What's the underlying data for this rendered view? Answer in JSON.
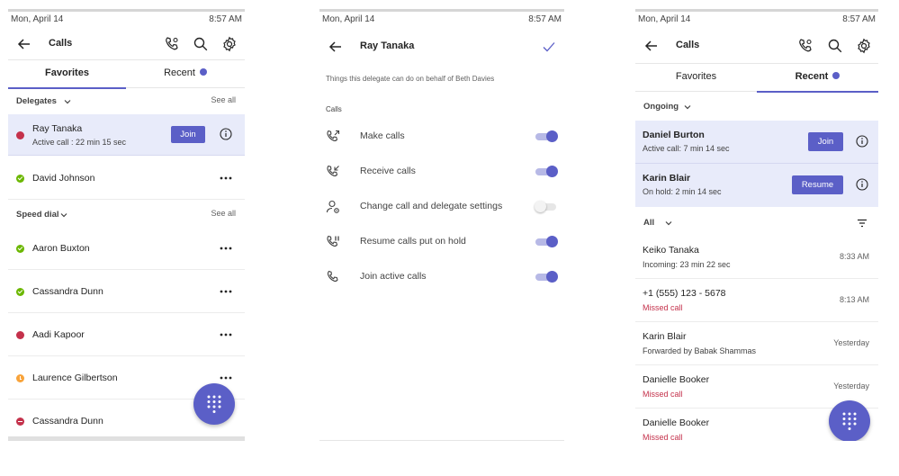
{
  "status": {
    "date": "Mon, April 14",
    "time": "8:57 AM"
  },
  "screen1": {
    "title": "Calls",
    "tabs": [
      {
        "label": "Favorites",
        "active": true
      },
      {
        "label": "Recent",
        "active": false,
        "badge": true
      }
    ],
    "delegates_section": {
      "label": "Delegates",
      "see_all": "See all"
    },
    "delegates": [
      {
        "name": "Ray Tanaka",
        "sub": "Active call : 22 min 15 sec",
        "presence": "red",
        "action": "Join",
        "highlighted": true
      },
      {
        "name": "David Johnson",
        "presence": "available"
      }
    ],
    "speed_dial_section": {
      "label": "Speed dial",
      "see_all": "See all"
    },
    "speed_dial": [
      {
        "name": "Aaron Buxton",
        "presence": "available"
      },
      {
        "name": "Cassandra Dunn",
        "presence": "available"
      },
      {
        "name": "Aadi Kapoor",
        "presence": "busy"
      },
      {
        "name": "Laurence Gilbertson",
        "presence": "away"
      },
      {
        "name": "Cassandra Dunn",
        "presence": "dnd"
      }
    ]
  },
  "screen2": {
    "title": "Ray Tanaka",
    "description": "Things this delegate can do on behalf of Beth Davies",
    "section_label": "Calls",
    "permissions": [
      {
        "label": "Make calls",
        "icon": "phone-outgoing-icon",
        "enabled": true
      },
      {
        "label": "Receive calls",
        "icon": "phone-incoming-icon",
        "enabled": true
      },
      {
        "label": "Change call and delegate settings",
        "icon": "person-settings-icon",
        "enabled": false
      },
      {
        "label": "Resume calls put on hold",
        "icon": "phone-pause-icon",
        "enabled": true
      },
      {
        "label": "Join active calls",
        "icon": "phone-icon",
        "enabled": true
      }
    ]
  },
  "screen3": {
    "title": "Calls",
    "tabs": [
      {
        "label": "Favorites",
        "active": false
      },
      {
        "label": "Recent",
        "active": true,
        "badge": true
      }
    ],
    "ongoing_section": {
      "label": "Ongoing"
    },
    "ongoing": [
      {
        "name": "Daniel Burton",
        "sub": "Active call: 7 min 14 sec",
        "action": "Join"
      },
      {
        "name": "Karin Blair",
        "sub": "On hold: 2 min 14 sec",
        "action": "Resume"
      }
    ],
    "all_section": {
      "label": "All"
    },
    "recent": [
      {
        "name": "Keiko Tanaka",
        "sub": "Incoming: 23 min 22 sec",
        "missed": false,
        "time": "8:33 AM"
      },
      {
        "name": "+1 (555) 123 - 5678",
        "sub": "Missed call",
        "missed": true,
        "time": "8:13 AM"
      },
      {
        "name": "Karin Blair",
        "sub": "Forwarded by Babak Shammas",
        "missed": false,
        "time": "Yesterday"
      },
      {
        "name": "Danielle Booker",
        "sub": "Missed call",
        "missed": true,
        "time": "Yesterday"
      },
      {
        "name": "Danielle Booker",
        "sub": "Missed call",
        "missed": true,
        "time": ""
      }
    ]
  },
  "colors": {
    "accent": "#5b5fc7",
    "highlight": "#e8ebfa",
    "missed": "#c4314b",
    "available": "#6bb700",
    "away": "#f8a33a"
  }
}
